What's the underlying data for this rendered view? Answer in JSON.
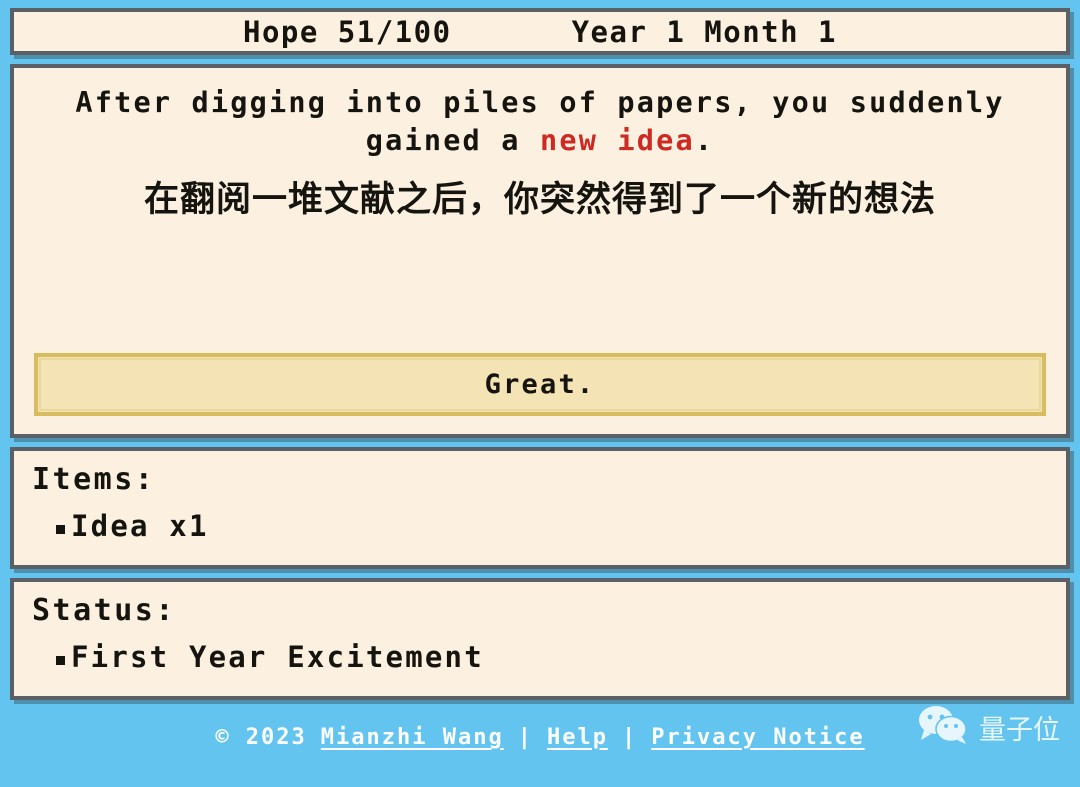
{
  "header": {
    "hope_label": "Hope 51/100",
    "time_label": "Year 1 Month 1"
  },
  "story": {
    "english_prefix": "After digging into piles of papers, you suddenly gained a ",
    "english_highlight": "new idea",
    "english_suffix": ".",
    "chinese": "在翻阅一堆文献之后，你突然得到了一个新的想法",
    "highlight_color": "#cc2a22"
  },
  "choices": [
    {
      "label": "Great."
    }
  ],
  "items": {
    "title": "Items:",
    "entries": [
      {
        "label": "Idea x1"
      }
    ]
  },
  "status": {
    "title": "Status:",
    "entries": [
      {
        "label": "First Year Excitement"
      }
    ]
  },
  "footer": {
    "copyright": "© 2023",
    "author": "Mianzhi Wang",
    "separator": "|",
    "help": "Help",
    "privacy": "Privacy Notice"
  },
  "watermark": {
    "text": "量子位"
  },
  "theme": {
    "background": "#63c5ef",
    "panel_fill": "#fcf1e0",
    "panel_border": "#5b6066",
    "button_fill": "#f3e3b5",
    "button_border": "#d9bc60",
    "text": "#16140f",
    "footer_text": "#ffffff"
  }
}
